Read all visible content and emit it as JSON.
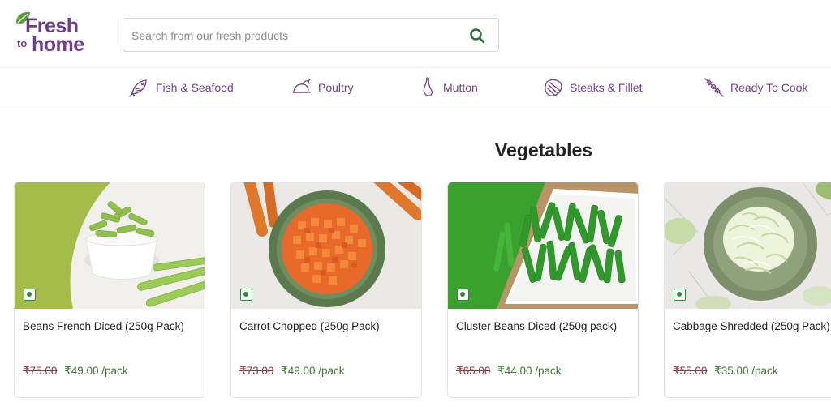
{
  "header": {
    "logo": {
      "line1": "Fresh",
      "line2": "to",
      "line3": "home"
    },
    "search": {
      "placeholder": "Search from our fresh products",
      "value": "",
      "icon": "search-icon"
    }
  },
  "categories": [
    {
      "label": "Fish & Seafood",
      "icon": "fish-icon"
    },
    {
      "label": "Poultry",
      "icon": "poultry-icon"
    },
    {
      "label": "Mutton",
      "icon": "mutton-icon"
    },
    {
      "label": "Steaks & Fillet",
      "icon": "steak-icon"
    },
    {
      "label": "Ready To Cook",
      "icon": "skewer-icon"
    }
  ],
  "section": {
    "title": "Vegetables"
  },
  "products": [
    {
      "name": "Beans French Diced (250g Pack)",
      "mrp": "₹75.00",
      "price": "₹49.00",
      "unit": "/pack"
    },
    {
      "name": "Carrot Chopped (250g Pack)",
      "mrp": "₹73.00",
      "price": "₹49.00",
      "unit": "/pack"
    },
    {
      "name": "Cluster Beans Diced (250g pack)",
      "mrp": "₹65.00",
      "price": "₹44.00",
      "unit": "/pack"
    },
    {
      "name": "Cabbage Shredded (250g Pack)",
      "mrp": "₹55.00",
      "price": "₹35.00",
      "unit": "/pack"
    }
  ],
  "colors": {
    "brand": "#6d3d8f",
    "leaf": "#5b9a3a",
    "price": "#3c7a30",
    "mrp": "#a0313a",
    "veg_mark": "#2e8b3e"
  }
}
